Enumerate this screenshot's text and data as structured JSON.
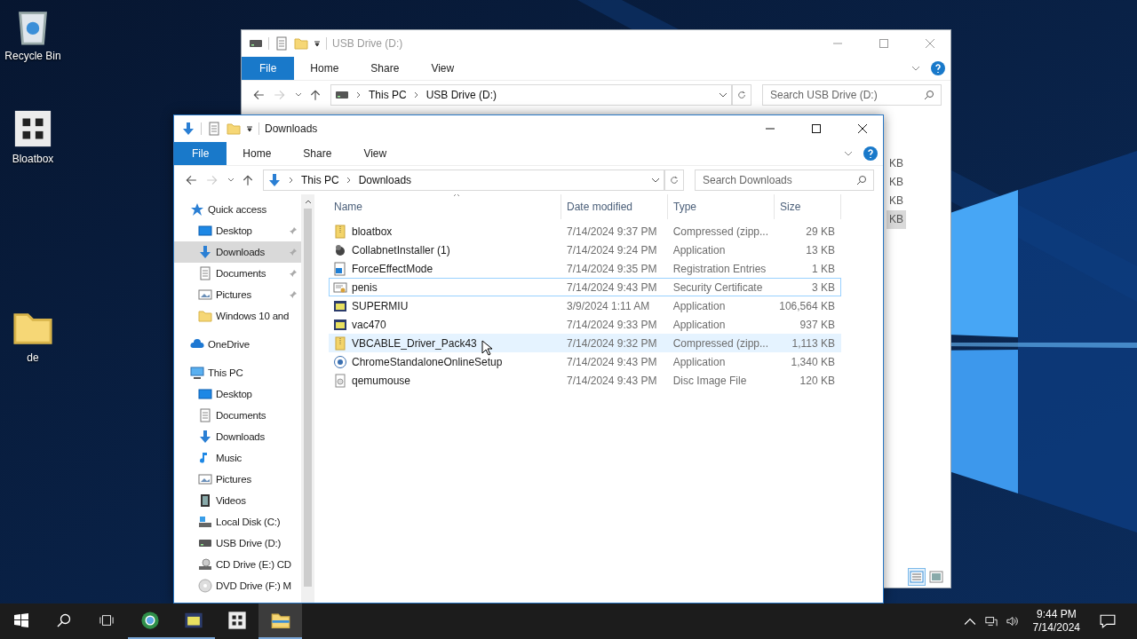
{
  "desktop": {
    "icons": [
      {
        "label": "Recycle Bin",
        "kind": "recycle"
      },
      {
        "label": "Bloatbox",
        "kind": "bloatbox"
      },
      {
        "label": "de",
        "kind": "folder"
      }
    ]
  },
  "back_window": {
    "title": "USB Drive (D:)",
    "ribbon_tabs": [
      {
        "label": "File",
        "kind": "file_menu"
      },
      {
        "label": "Home",
        "kind": "tab"
      },
      {
        "label": "Share",
        "kind": "tab"
      },
      {
        "label": "View",
        "kind": "tab"
      }
    ],
    "address": [
      "This PC",
      "USB Drive (D:)"
    ],
    "search": {
      "placeholder": "Search USB Drive (D:)"
    },
    "size_cells": [
      {
        "text": "KB",
        "selected": false
      },
      {
        "text": "KB",
        "selected": false
      },
      {
        "text": "KB",
        "selected": false
      },
      {
        "text": "KB",
        "selected": true
      }
    ],
    "view_buttons": [
      {
        "kind": "details",
        "selected": true
      },
      {
        "kind": "large_icons",
        "selected": false
      }
    ]
  },
  "window": {
    "title": "Downloads",
    "ribbon_tabs": [
      {
        "label": "File",
        "kind": "file_menu"
      },
      {
        "label": "Home",
        "kind": "tab"
      },
      {
        "label": "Share",
        "kind": "tab"
      },
      {
        "label": "View",
        "kind": "tab"
      }
    ],
    "address": [
      "This PC",
      "Downloads"
    ],
    "search": {
      "placeholder": "Search Downloads"
    },
    "sidebar": [
      {
        "label": "Quick access",
        "kind": "star",
        "selected": false,
        "children": [
          {
            "label": "Desktop",
            "kind": "desktop",
            "pinned": true,
            "selected": false
          },
          {
            "label": "Downloads",
            "kind": "downloads",
            "pinned": true,
            "selected": true
          },
          {
            "label": "Documents",
            "kind": "documents",
            "pinned": true,
            "selected": false
          },
          {
            "label": "Pictures",
            "kind": "pictures",
            "pinned": true,
            "selected": false
          },
          {
            "label": "Windows 10 and",
            "kind": "folder",
            "pinned": false,
            "selected": false
          }
        ]
      },
      {
        "label": "OneDrive",
        "kind": "cloud",
        "selected": false
      },
      {
        "label": "This PC",
        "kind": "pc",
        "selected": false,
        "children": [
          {
            "label": "Desktop",
            "kind": "desktop",
            "pinned": false,
            "selected": false
          },
          {
            "label": "Documents",
            "kind": "documents",
            "pinned": false,
            "selected": false
          },
          {
            "label": "Downloads",
            "kind": "downloads",
            "pinned": false,
            "selected": false
          },
          {
            "label": "Music",
            "kind": "music",
            "pinned": false,
            "selected": false
          },
          {
            "label": "Pictures",
            "kind": "pictures",
            "pinned": false,
            "selected": false
          },
          {
            "label": "Videos",
            "kind": "videos",
            "pinned": false,
            "selected": false
          },
          {
            "label": "Local Disk (C:)",
            "kind": "disk",
            "pinned": false,
            "selected": false
          },
          {
            "label": "USB Drive (D:)",
            "kind": "usb",
            "pinned": false,
            "selected": false
          },
          {
            "label": "CD Drive (E:) CD",
            "kind": "cd",
            "pinned": false,
            "selected": false
          },
          {
            "label": "DVD Drive (F:) M",
            "kind": "dvd",
            "pinned": false,
            "selected": false
          }
        ]
      }
    ],
    "columns": [
      "Name",
      "Date modified",
      "Type",
      "Size"
    ],
    "rows": [
      {
        "name": "bloatbox",
        "date": "7/14/2024 9:37 PM",
        "type": "Compressed (zipp...",
        "size": "29 KB",
        "kind": "zip",
        "focused": false,
        "hovered": false
      },
      {
        "name": "CollabnetInstaller (1)",
        "date": "7/14/2024 9:24 PM",
        "type": "Application",
        "size": "13 KB",
        "kind": "installer",
        "focused": false,
        "hovered": false
      },
      {
        "name": "ForceEffectMode",
        "date": "7/14/2024 9:35 PM",
        "type": "Registration Entries",
        "size": "1 KB",
        "kind": "reg",
        "focused": false,
        "hovered": false
      },
      {
        "name": "penis",
        "date": "7/14/2024 9:43 PM",
        "type": "Security Certificate",
        "size": "3 KB",
        "kind": "cert",
        "focused": true,
        "hovered": false
      },
      {
        "name": "SUPERMIU",
        "date": "3/9/2024 1:11 AM",
        "type": "Application",
        "size": "106,564 KB",
        "kind": "app",
        "focused": false,
        "hovered": false
      },
      {
        "name": "vac470",
        "date": "7/14/2024 9:33 PM",
        "type": "Application",
        "size": "937 KB",
        "kind": "app",
        "focused": false,
        "hovered": false
      },
      {
        "name": "VBCABLE_Driver_Pack43",
        "date": "7/14/2024 9:32 PM",
        "type": "Compressed (zipp...",
        "size": "1,113 KB",
        "kind": "zip",
        "focused": false,
        "hovered": true
      },
      {
        "name": "ChromeStandaloneOnlineSetup",
        "date": "7/14/2024 9:43 PM",
        "type": "Application",
        "size": "1,340 KB",
        "kind": "chrome",
        "focused": false,
        "hovered": false
      },
      {
        "name": "qemumouse",
        "date": "7/14/2024 9:43 PM",
        "type": "Disc Image File",
        "size": "120 KB",
        "kind": "disc",
        "focused": false,
        "hovered": false
      }
    ]
  },
  "taskbar": {
    "apps": [
      {
        "kind": "globe",
        "running": true,
        "active": false
      },
      {
        "kind": "app",
        "running": true,
        "active": false
      },
      {
        "kind": "bloatbox",
        "running": false,
        "active": false
      },
      {
        "kind": "explorer",
        "running": true,
        "active": true
      }
    ],
    "clock": {
      "time": "9:44 PM",
      "date": "7/14/2024"
    }
  }
}
